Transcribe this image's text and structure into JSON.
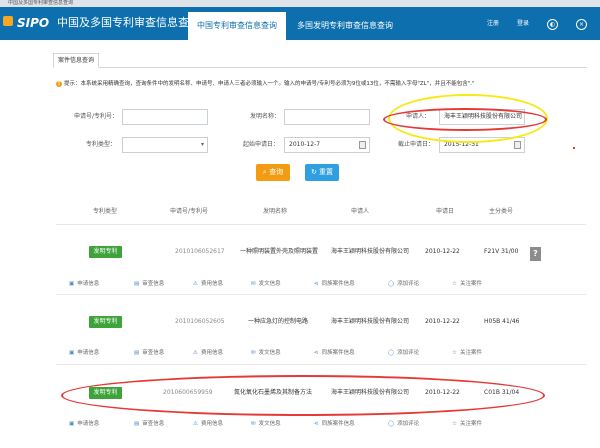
{
  "window": {
    "title": "中国及多国专利审查信息查询"
  },
  "header": {
    "brand": "SIPO",
    "system_name": "中国及多国专利审查信息查询",
    "nav_tabs": [
      {
        "label": "中国专利审查信息查询",
        "active": true
      },
      {
        "label": "多国发明专利审查信息查询",
        "active": false
      }
    ],
    "register_label": "注册",
    "login_label": "登录",
    "icons": [
      "globe-icon",
      "close-icon"
    ]
  },
  "subtab": {
    "label": "案件信息查询"
  },
  "tip": "提示：本系统采用精确查询，查询条件中的发明名称、申请号、申请人三者必须输入一个。输入的申请号/专利号必须为9位或13位，不需输入字母\"ZL\"，并且不能包含\".\"",
  "form": {
    "application_no": {
      "label": "申请号/专利号：",
      "value": ""
    },
    "invention_name": {
      "label": "发明名称：",
      "value": ""
    },
    "applicant": {
      "label": "申请人：",
      "value": "海丰王颖明科技股份有限公司"
    },
    "patent_type": {
      "label": "专利类型：",
      "value": ""
    },
    "start_date": {
      "label": "起始申请日：",
      "value": "2010-12-7"
    },
    "end_date": {
      "label": "截止申请日：",
      "value": "2015-12-31"
    }
  },
  "buttons": {
    "search": "查询",
    "reset": "重置"
  },
  "colors": {
    "brand_blue": "#0d6fae",
    "search_orange": "#f39c12",
    "reset_blue": "#2f9fe0",
    "tag_green": "#3fa33b",
    "annotation_red": "#e53935",
    "annotation_yellow": "#f5ea14"
  },
  "table": {
    "headers": [
      "专利类型",
      "申请号/专利号",
      "发明名称",
      "申请人",
      "申请日",
      "主分类号"
    ],
    "rows": [
      {
        "type": "发明专利",
        "app_no": "2010106052617",
        "title": "一种照明装置外壳及照明装置",
        "applicant": "海丰王颖明科技股份有限公司",
        "date": "2010-12-22",
        "ipc": "F21V 31/00"
      },
      {
        "type": "发明专利",
        "app_no": "2010106052605",
        "title": "一种应急灯的控制电路",
        "applicant": "海丰王颖明科技股份有限公司",
        "date": "2010-12-22",
        "ipc": "H05B 41/46"
      },
      {
        "type": "发明专利",
        "app_no": "2010600659959",
        "title": "氮化氧化石墨烯及其制备方法",
        "applicant": "海丰王颖明科技股份有限公司",
        "date": "2010-12-22",
        "ipc": "C01B 31/04"
      }
    ],
    "actions": [
      "申请信息",
      "审查信息",
      "费用信息",
      "发文信息",
      "同族案件信息",
      "添加评论",
      "关注案件"
    ]
  }
}
